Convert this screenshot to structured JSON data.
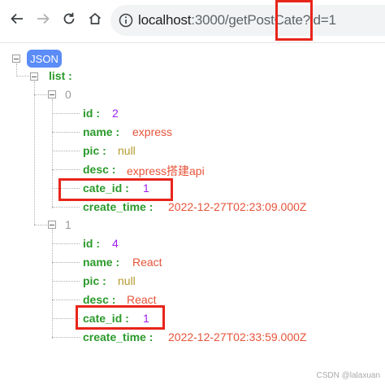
{
  "browser": {
    "url_host": "localhost",
    "url_path": ":3000/getPostCate?id=1"
  },
  "json_view": {
    "badge": "JSON",
    "list_key": "list :",
    "items": [
      {
        "index": "0",
        "fields": [
          {
            "key": "id :",
            "value": "2",
            "type": "num"
          },
          {
            "key": "name :",
            "value": "express",
            "type": "str"
          },
          {
            "key": "pic :",
            "value": "null",
            "type": "null"
          },
          {
            "key": "desc :",
            "value": "express搭建api",
            "type": "str"
          },
          {
            "key": "cate_id :",
            "value": "1",
            "type": "num"
          },
          {
            "key": "create_time :",
            "value": "2022-12-27T02:23:09.000Z",
            "type": "str"
          }
        ]
      },
      {
        "index": "1",
        "fields": [
          {
            "key": "id :",
            "value": "4",
            "type": "num"
          },
          {
            "key": "name :",
            "value": "React",
            "type": "str"
          },
          {
            "key": "pic :",
            "value": "null",
            "type": "null"
          },
          {
            "key": "desc :",
            "value": "React",
            "type": "str"
          },
          {
            "key": "cate_id :",
            "value": "1",
            "type": "num"
          },
          {
            "key": "create_time :",
            "value": "2022-12-27T02:33:59.000Z",
            "type": "str"
          }
        ]
      }
    ]
  },
  "watermark": "CSDN @lalaxuan",
  "colors": {
    "key": "#2b9a2b",
    "number": "#a020f0",
    "string": "#e6543a",
    "null": "#b59a2e",
    "highlight": "#e8251b",
    "badge": "#5b8cf7"
  }
}
